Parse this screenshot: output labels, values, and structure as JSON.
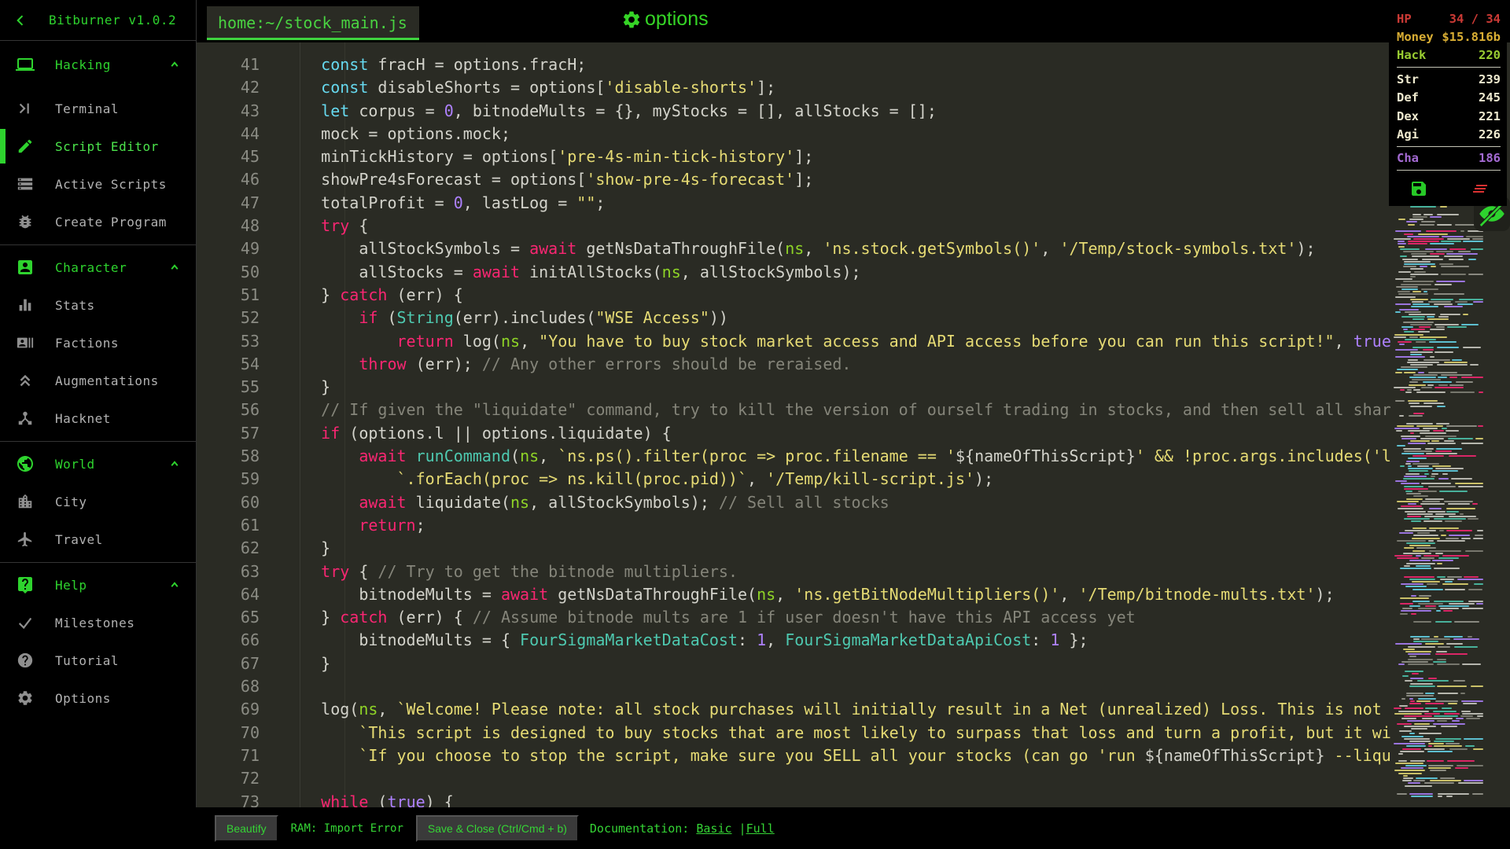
{
  "app": {
    "title": "Bitburner v1.0.2"
  },
  "sidebar": {
    "sections": [
      {
        "label": "Hacking",
        "items": [
          {
            "label": "Terminal"
          },
          {
            "label": "Script Editor"
          },
          {
            "label": "Active Scripts"
          },
          {
            "label": "Create Program"
          }
        ]
      },
      {
        "label": "Character",
        "items": [
          {
            "label": "Stats"
          },
          {
            "label": "Factions"
          },
          {
            "label": "Augmentations"
          },
          {
            "label": "Hacknet"
          }
        ]
      },
      {
        "label": "World",
        "items": [
          {
            "label": "City"
          },
          {
            "label": "Travel"
          }
        ]
      },
      {
        "label": "Help",
        "items": [
          {
            "label": "Milestones"
          },
          {
            "label": "Tutorial"
          },
          {
            "label": "Options"
          }
        ]
      }
    ]
  },
  "editor": {
    "tab": "home:~/stock_main.js",
    "options_label": "options",
    "lines": [
      {
        "n": 41,
        "seg": [
          [
            "w",
            "    "
          ],
          [
            "b",
            "const"
          ],
          [
            "w",
            " fracH = options.fracH;"
          ]
        ]
      },
      {
        "n": 42,
        "seg": [
          [
            "w",
            "    "
          ],
          [
            "b",
            "const"
          ],
          [
            "w",
            " disableShorts = options["
          ],
          [
            "s",
            "'disable-shorts'"
          ],
          [
            "w",
            "];"
          ]
        ]
      },
      {
        "n": 43,
        "seg": [
          [
            "w",
            "    "
          ],
          [
            "b",
            "let"
          ],
          [
            "w",
            " corpus = "
          ],
          [
            "n",
            "0"
          ],
          [
            "w",
            ", bitnodeMults = {}, myStocks = [], allStocks = [];"
          ]
        ]
      },
      {
        "n": 44,
        "seg": [
          [
            "w",
            "    mock = options.mock;"
          ]
        ]
      },
      {
        "n": 45,
        "seg": [
          [
            "w",
            "    minTickHistory = options["
          ],
          [
            "s",
            "'pre-4s-min-tick-history'"
          ],
          [
            "w",
            "];"
          ]
        ]
      },
      {
        "n": 46,
        "seg": [
          [
            "w",
            "    showPre4sForecast = options["
          ],
          [
            "s",
            "'show-pre-4s-forecast'"
          ],
          [
            "w",
            "];"
          ]
        ]
      },
      {
        "n": 47,
        "seg": [
          [
            "w",
            "    totalProfit = "
          ],
          [
            "n",
            "0"
          ],
          [
            "w",
            ", lastLog = "
          ],
          [
            "s",
            "\"\""
          ],
          [
            "w",
            ";"
          ]
        ]
      },
      {
        "n": 48,
        "seg": [
          [
            "w",
            "    "
          ],
          [
            "p",
            "try"
          ],
          [
            "w",
            " {"
          ]
        ]
      },
      {
        "n": 49,
        "seg": [
          [
            "w",
            "        allStockSymbols = "
          ],
          [
            "p",
            "await"
          ],
          [
            "w",
            " getNsDataThroughFile("
          ],
          [
            "g",
            "ns"
          ],
          [
            "w",
            ", "
          ],
          [
            "s",
            "'ns.stock.getSymbols()'"
          ],
          [
            "w",
            ", "
          ],
          [
            "s",
            "'/Temp/stock-symbols.txt'"
          ],
          [
            "w",
            ");"
          ]
        ]
      },
      {
        "n": 50,
        "seg": [
          [
            "w",
            "        allStocks = "
          ],
          [
            "p",
            "await"
          ],
          [
            "w",
            " initAllStocks("
          ],
          [
            "g",
            "ns"
          ],
          [
            "w",
            ", allStockSymbols);"
          ]
        ]
      },
      {
        "n": 51,
        "seg": [
          [
            "w",
            "    } "
          ],
          [
            "p",
            "catch"
          ],
          [
            "w",
            " (err) {"
          ]
        ]
      },
      {
        "n": 52,
        "seg": [
          [
            "w",
            "        "
          ],
          [
            "p",
            "if"
          ],
          [
            "w",
            " ("
          ],
          [
            "f",
            "String"
          ],
          [
            "w",
            "(err).includes("
          ],
          [
            "s",
            "\"WSE Access\""
          ],
          [
            "w",
            "))"
          ]
        ]
      },
      {
        "n": 53,
        "seg": [
          [
            "w",
            "            "
          ],
          [
            "p",
            "return"
          ],
          [
            "w",
            " log("
          ],
          [
            "g",
            "ns"
          ],
          [
            "w",
            ", "
          ],
          [
            "s",
            "\"You have to buy stock market access and API access before you can run this script!\""
          ],
          [
            "w",
            ", "
          ],
          [
            "n",
            "true"
          ],
          [
            "w",
            ");"
          ]
        ]
      },
      {
        "n": 54,
        "seg": [
          [
            "w",
            "        "
          ],
          [
            "p",
            "throw"
          ],
          [
            "w",
            " (err); "
          ],
          [
            "c",
            "// Any other errors should be reraised."
          ]
        ]
      },
      {
        "n": 55,
        "seg": [
          [
            "w",
            "    }"
          ]
        ]
      },
      {
        "n": 56,
        "seg": [
          [
            "w",
            "    "
          ],
          [
            "c",
            "// If given the \"liquidate\" command, try to kill the version of ourself trading in stocks, and then sell all shares."
          ]
        ]
      },
      {
        "n": 57,
        "seg": [
          [
            "w",
            "    "
          ],
          [
            "p",
            "if"
          ],
          [
            "w",
            " (options.l || options.liquidate) {"
          ]
        ]
      },
      {
        "n": 58,
        "seg": [
          [
            "w",
            "        "
          ],
          [
            "p",
            "await"
          ],
          [
            "w",
            " "
          ],
          [
            "f",
            "runCommand"
          ],
          [
            "w",
            "("
          ],
          [
            "g",
            "ns"
          ],
          [
            "w",
            ", "
          ],
          [
            "s",
            "`ns.ps().filter(proc => proc.filename == '"
          ],
          [
            "w",
            "${nameOfThisScript}"
          ],
          [
            "s",
            "' && !proc.args.includes('liquidate'))"
          ]
        ]
      },
      {
        "n": 59,
        "seg": [
          [
            "w",
            "            "
          ],
          [
            "s",
            "`.forEach(proc => ns.kill(proc.pid))`"
          ],
          [
            "w",
            ", "
          ],
          [
            "s",
            "'/Temp/kill-script.js'"
          ],
          [
            "w",
            ");"
          ]
        ]
      },
      {
        "n": 60,
        "seg": [
          [
            "w",
            "        "
          ],
          [
            "p",
            "await"
          ],
          [
            "w",
            " liquidate("
          ],
          [
            "g",
            "ns"
          ],
          [
            "w",
            ", allStockSymbols); "
          ],
          [
            "c",
            "// Sell all stocks"
          ]
        ]
      },
      {
        "n": 61,
        "seg": [
          [
            "w",
            "        "
          ],
          [
            "p",
            "return"
          ],
          [
            "w",
            ";"
          ]
        ]
      },
      {
        "n": 62,
        "seg": [
          [
            "w",
            "    }"
          ]
        ]
      },
      {
        "n": 63,
        "seg": [
          [
            "w",
            "    "
          ],
          [
            "p",
            "try"
          ],
          [
            "w",
            " { "
          ],
          [
            "c",
            "// Try to get the bitnode multipliers."
          ]
        ]
      },
      {
        "n": 64,
        "seg": [
          [
            "w",
            "        bitnodeMults = "
          ],
          [
            "p",
            "await"
          ],
          [
            "w",
            " getNsDataThroughFile("
          ],
          [
            "g",
            "ns"
          ],
          [
            "w",
            ", "
          ],
          [
            "s",
            "'ns.getBitNodeMultipliers()'"
          ],
          [
            "w",
            ", "
          ],
          [
            "s",
            "'/Temp/bitnode-mults.txt'"
          ],
          [
            "w",
            ");"
          ]
        ]
      },
      {
        "n": 65,
        "seg": [
          [
            "w",
            "    } "
          ],
          [
            "p",
            "catch"
          ],
          [
            "w",
            " (err) { "
          ],
          [
            "c",
            "// Assume bitnode mults are 1 if user doesn't have this API access yet"
          ]
        ]
      },
      {
        "n": 66,
        "seg": [
          [
            "w",
            "        bitnodeMults = { "
          ],
          [
            "f",
            "FourSigmaMarketDataCost"
          ],
          [
            "w",
            ": "
          ],
          [
            "n",
            "1"
          ],
          [
            "w",
            ", "
          ],
          [
            "f",
            "FourSigmaMarketDataApiCost"
          ],
          [
            "w",
            ": "
          ],
          [
            "n",
            "1"
          ],
          [
            "w",
            " };"
          ]
        ]
      },
      {
        "n": 67,
        "seg": [
          [
            "w",
            "    }"
          ]
        ]
      },
      {
        "n": 68,
        "seg": [
          [
            "w",
            ""
          ]
        ]
      },
      {
        "n": 69,
        "seg": [
          [
            "w",
            "    log("
          ],
          [
            "g",
            "ns"
          ],
          [
            "w",
            ", "
          ],
          [
            "s",
            "`Welcome! Please note: all stock purchases will initially result in a Net (unrealized) Loss. This is not only expected"
          ]
        ]
      },
      {
        "n": 70,
        "seg": [
          [
            "w",
            "        "
          ],
          [
            "s",
            "`This script is designed to buy stocks that are most likely to surpass that loss and turn a profit, but it will take time"
          ]
        ]
      },
      {
        "n": 71,
        "seg": [
          [
            "w",
            "        "
          ],
          [
            "s",
            "`If you choose to stop the script, make sure you SELL all your stocks (can go 'run "
          ],
          [
            "w",
            "${nameOfThisScript}"
          ],
          [
            "s",
            " --liquidate')"
          ]
        ]
      },
      {
        "n": 72,
        "seg": [
          [
            "w",
            ""
          ]
        ]
      },
      {
        "n": 73,
        "seg": [
          [
            "w",
            "    "
          ],
          [
            "p",
            "while"
          ],
          [
            "w",
            " ("
          ],
          [
            "n",
            "true"
          ],
          [
            "w",
            ") {"
          ]
        ]
      }
    ]
  },
  "stats": {
    "rows": [
      {
        "label": "HP",
        "value": "34 / 34"
      },
      {
        "label": "Money",
        "value": "$15.816b"
      },
      {
        "label": "Hack",
        "value": "220"
      },
      {
        "label": "Str",
        "value": "239"
      },
      {
        "label": "Def",
        "value": "245"
      },
      {
        "label": "Dex",
        "value": "221"
      },
      {
        "label": "Agi",
        "value": "226"
      },
      {
        "label": "Cha",
        "value": "186"
      }
    ]
  },
  "footer": {
    "beautify": "Beautify",
    "ram": "RAM: Import Error",
    "save": "Save & Close (Ctrl/Cmd + b)",
    "doc_label": "Documentation:",
    "doc_basic": "Basic",
    "doc_sep": "|",
    "doc_full": "Full"
  },
  "colors": {
    "accent_green": "#2ed32e",
    "hp_red": "#cb3a35",
    "money_yellow": "#d9ae34",
    "hack_green": "#9acd32",
    "stat_cream": "#efeacf",
    "cha_purple": "#a46ad3"
  }
}
